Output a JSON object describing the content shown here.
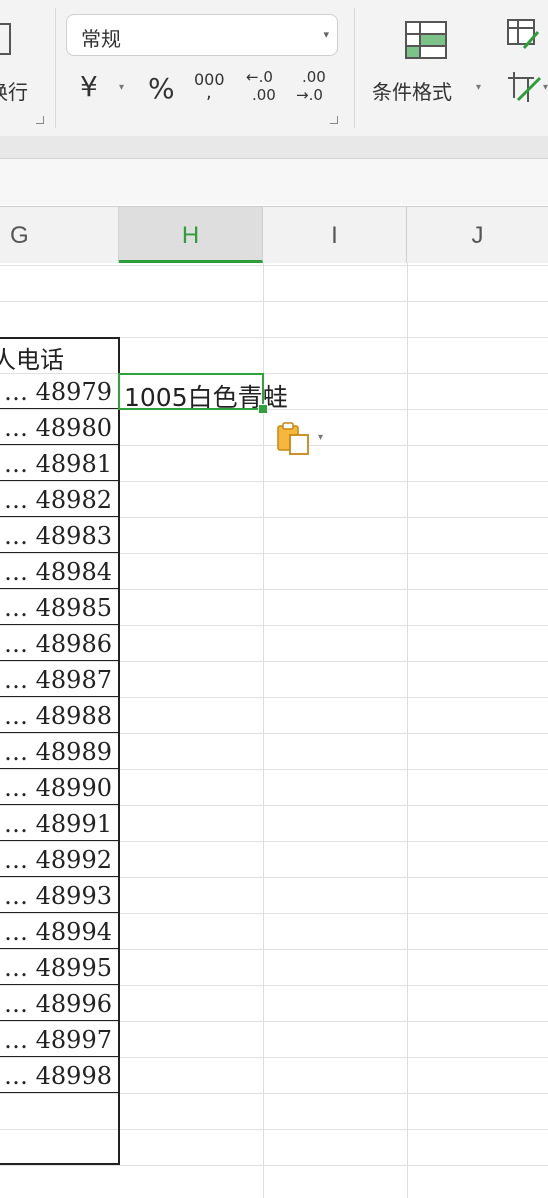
{
  "ribbon": {
    "wrap_label_partial": "换行",
    "number_format_value": "常规",
    "currency_symbol": "¥",
    "percent_symbol": "%",
    "thousands_symbol_top": "000",
    "thousands_symbol_bottom": ",",
    "decimal_increase_top": "←.0",
    "decimal_increase_bottom": ".00",
    "decimal_decrease_top": ".00",
    "decimal_decrease_bottom": "→.0",
    "conditional_format_label": "条件格式"
  },
  "columns": [
    {
      "label": "G",
      "active": false
    },
    {
      "label": "H",
      "active": true
    },
    {
      "label": "I",
      "active": false
    },
    {
      "label": "J",
      "active": false
    }
  ],
  "column_g": {
    "header_partial": "人电话",
    "values": [
      "… 48979",
      "… 48980",
      "… 48981",
      "… 48982",
      "… 48983",
      "… 48984",
      "… 48985",
      "… 48986",
      "… 48987",
      "… 48988",
      "… 48989",
      "… 48990",
      "… 48991",
      "… 48992",
      "… 48993",
      "… 48994",
      "… 48995",
      "… 48996",
      "… 48997",
      "… 48998"
    ]
  },
  "active_cell": {
    "value": "1005白色青蛙"
  },
  "colors": {
    "selection": "#2ea33b",
    "paste_icon": "#e8a21c"
  }
}
